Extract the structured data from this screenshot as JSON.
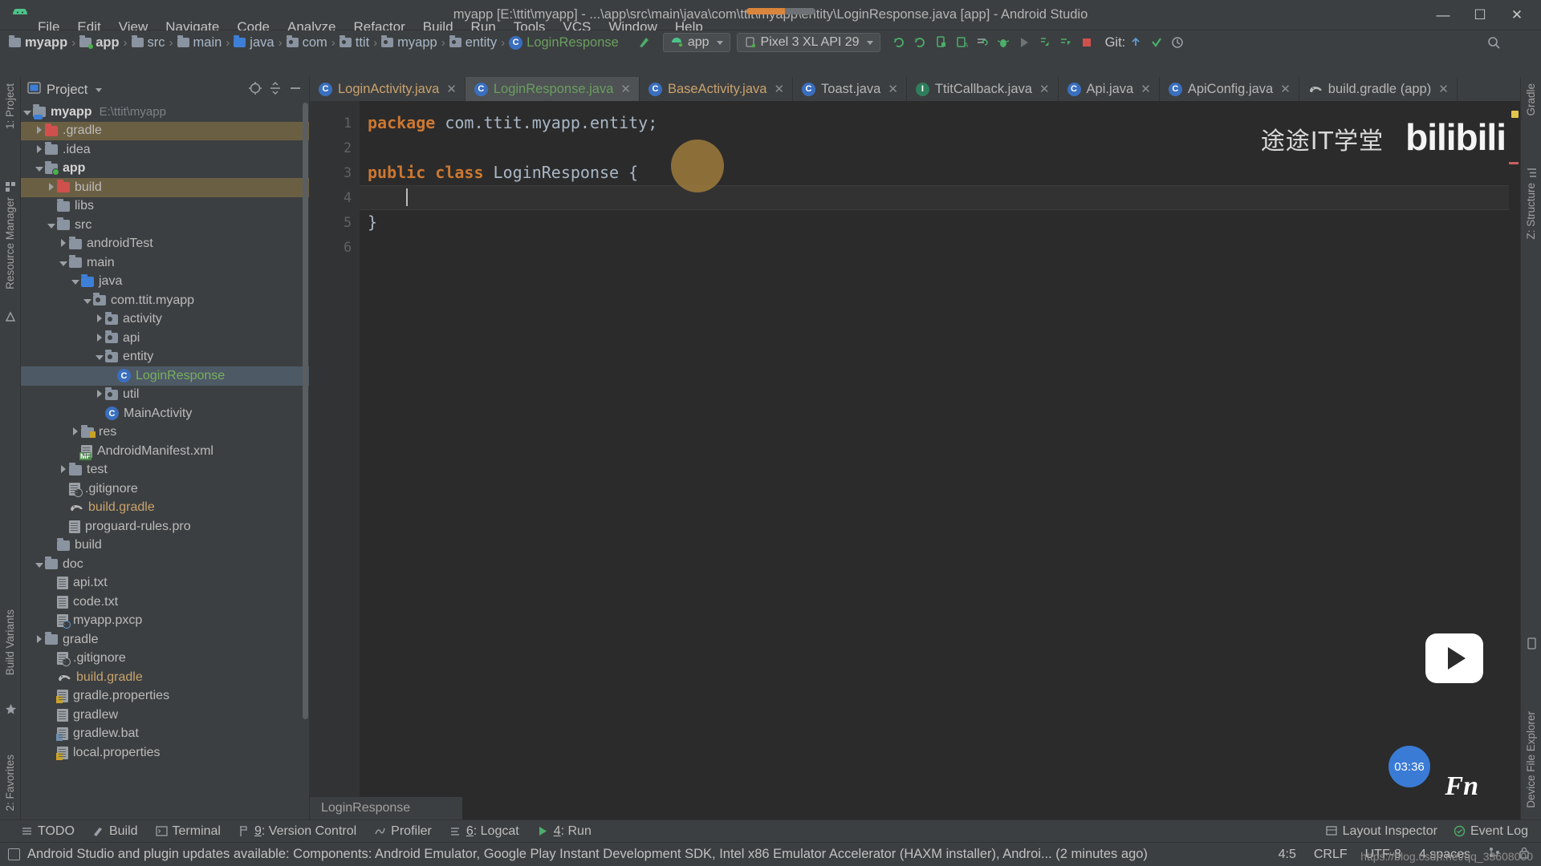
{
  "window": {
    "title": "myapp [E:\\ttit\\myapp] - ...\\app\\src\\main\\java\\com\\ttit\\myapp\\entity\\LoginResponse.java [app] - Android Studio",
    "minimize": "—",
    "maximize": "☐",
    "close": "✕"
  },
  "menubar": {
    "items": [
      {
        "label": "File"
      },
      {
        "label": "Edit"
      },
      {
        "label": "View"
      },
      {
        "label": "Navigate"
      },
      {
        "label": "Code"
      },
      {
        "label": "Analyze"
      },
      {
        "label": "Refactor"
      },
      {
        "label": "Build"
      },
      {
        "label": "Run"
      },
      {
        "label": "Tools"
      },
      {
        "label": "VCS"
      },
      {
        "label": "Window"
      },
      {
        "label": "Help"
      }
    ]
  },
  "breadcrumb": {
    "items": [
      {
        "label": "myapp",
        "icon": "folder-project",
        "bold": true
      },
      {
        "label": "app",
        "icon": "folder-module",
        "bold": true
      },
      {
        "label": "src",
        "icon": "folder",
        "bold": false
      },
      {
        "label": "main",
        "icon": "folder",
        "bold": false
      },
      {
        "label": "java",
        "icon": "folder-source",
        "bold": false
      },
      {
        "label": "com",
        "icon": "folder-package",
        "bold": false
      },
      {
        "label": "ttit",
        "icon": "folder-package",
        "bold": false
      },
      {
        "label": "myapp",
        "icon": "folder-package",
        "bold": false
      },
      {
        "label": "entity",
        "icon": "folder-package",
        "bold": false
      },
      {
        "label": "LoginResponse",
        "icon": "class-icon",
        "bold": false
      }
    ],
    "separator": "›"
  },
  "toolbar": {
    "run_config": "app",
    "device": "Pixel 3 XL API 29",
    "git_label": "Git:",
    "icons": [
      "sync-gradle-icon",
      "avd-manager-icon",
      "sdk-manager-icon",
      "search-everywhere-icon",
      "project-structure-icon",
      "stop-icon",
      "run-icon",
      "debug-icon",
      "attach-debugger-icon",
      "profile-icon",
      "apply-changes-icon",
      "stop-app-icon",
      "commit-icon",
      "update-icon",
      "history-icon"
    ]
  },
  "project_panel": {
    "title": "Project",
    "select_opened_file_icon": "target-icon",
    "collapse_all_icon": "collapse-icon",
    "hide_icon": "minimize-icon",
    "tree": [
      {
        "label": "myapp",
        "path": "E:\\ttit\\myapp",
        "depth": 0,
        "arrow": "open",
        "icon": "folder-project",
        "bold": true,
        "state": "none"
      },
      {
        "label": ".gradle",
        "depth": 1,
        "arrow": "closed",
        "icon": "folder-red",
        "state": "hl"
      },
      {
        "label": ".idea",
        "depth": 1,
        "arrow": "closed",
        "icon": "folder",
        "state": "none"
      },
      {
        "label": "app",
        "depth": 1,
        "arrow": "open",
        "icon": "folder-module",
        "bold": true,
        "state": "none"
      },
      {
        "label": "build",
        "depth": 2,
        "arrow": "closed",
        "icon": "folder-red",
        "state": "hl"
      },
      {
        "label": "libs",
        "depth": 2,
        "arrow": "none",
        "icon": "folder",
        "state": "none"
      },
      {
        "label": "src",
        "depth": 2,
        "arrow": "open",
        "icon": "folder",
        "state": "none"
      },
      {
        "label": "androidTest",
        "depth": 3,
        "arrow": "closed",
        "icon": "folder",
        "state": "none"
      },
      {
        "label": "main",
        "depth": 3,
        "arrow": "open",
        "icon": "folder",
        "state": "none"
      },
      {
        "label": "java",
        "depth": 4,
        "arrow": "open",
        "icon": "folder-source",
        "state": "none"
      },
      {
        "label": "com.ttit.myapp",
        "depth": 5,
        "arrow": "open",
        "icon": "folder-package",
        "state": "none"
      },
      {
        "label": "activity",
        "depth": 6,
        "arrow": "closed",
        "icon": "folder-package",
        "state": "none"
      },
      {
        "label": "api",
        "depth": 6,
        "arrow": "closed",
        "icon": "folder-package",
        "state": "none"
      },
      {
        "label": "entity",
        "depth": 6,
        "arrow": "open",
        "icon": "folder-package",
        "state": "none"
      },
      {
        "label": "LoginResponse",
        "depth": 7,
        "arrow": "none",
        "icon": "class-icon",
        "color": "green",
        "state": "sel"
      },
      {
        "label": "util",
        "depth": 6,
        "arrow": "closed",
        "icon": "folder-package",
        "state": "none"
      },
      {
        "label": "MainActivity",
        "depth": 6,
        "arrow": "none",
        "icon": "class-icon",
        "state": "none"
      },
      {
        "label": "res",
        "depth": 4,
        "arrow": "closed",
        "icon": "folder-res",
        "state": "none"
      },
      {
        "label": "AndroidManifest.xml",
        "depth": 4,
        "arrow": "none",
        "icon": "manifest-icon",
        "state": "none"
      },
      {
        "label": "test",
        "depth": 3,
        "arrow": "closed",
        "icon": "folder",
        "state": "none"
      },
      {
        "label": ".gitignore",
        "depth": 3,
        "arrow": "none",
        "icon": "gitignore-icon",
        "state": "none"
      },
      {
        "label": "build.gradle",
        "depth": 3,
        "arrow": "none",
        "icon": "gradle-icon",
        "color": "gradle",
        "state": "none"
      },
      {
        "label": "proguard-rules.pro",
        "depth": 3,
        "arrow": "none",
        "icon": "file-icon",
        "state": "none"
      },
      {
        "label": "build",
        "depth": 2,
        "arrow": "none",
        "icon": "folder",
        "state": "none"
      },
      {
        "label": "doc",
        "depth": 1,
        "arrow": "open",
        "icon": "folder",
        "state": "none"
      },
      {
        "label": "api.txt",
        "depth": 2,
        "arrow": "none",
        "icon": "file-icon",
        "state": "none"
      },
      {
        "label": "code.txt",
        "depth": 2,
        "arrow": "none",
        "icon": "file-icon",
        "state": "none"
      },
      {
        "label": "myapp.pxcp",
        "depth": 2,
        "arrow": "none",
        "icon": "pxcp-icon",
        "state": "none"
      },
      {
        "label": "gradle",
        "depth": 1,
        "arrow": "closed",
        "icon": "folder",
        "state": "none"
      },
      {
        "label": ".gitignore",
        "depth": 2,
        "arrow": "none",
        "icon": "gitignore-icon",
        "state": "none"
      },
      {
        "label": "build.gradle",
        "depth": 2,
        "arrow": "none",
        "icon": "gradle-icon",
        "color": "gradle",
        "state": "none"
      },
      {
        "label": "gradle.properties",
        "depth": 2,
        "arrow": "none",
        "icon": "properties-icon",
        "state": "none"
      },
      {
        "label": "gradlew",
        "depth": 2,
        "arrow": "none",
        "icon": "file-icon",
        "state": "none"
      },
      {
        "label": "gradlew.bat",
        "depth": 2,
        "arrow": "none",
        "icon": "bat-icon",
        "state": "none"
      },
      {
        "label": "local.properties",
        "depth": 2,
        "arrow": "none",
        "icon": "properties-icon",
        "state": "none"
      }
    ]
  },
  "left_rail": {
    "items": [
      {
        "label": "1: Project"
      },
      {
        "label": "Resource Manager"
      },
      {
        "label": "Build Variants"
      },
      {
        "label": "2: Favorites"
      }
    ]
  },
  "right_rail": {
    "items": [
      {
        "label": "Gradle"
      },
      {
        "label": "Z: Structure"
      },
      {
        "label": "Device File Explorer"
      }
    ]
  },
  "editor": {
    "tabs": [
      {
        "label": "LoginActivity.java",
        "icon": "class-icon",
        "color": "amber",
        "active": false
      },
      {
        "label": "LoginResponse.java",
        "icon": "class-icon",
        "color": "green",
        "active": true
      },
      {
        "label": "BaseActivity.java",
        "icon": "class-icon",
        "color": "amber",
        "active": false
      },
      {
        "label": "Toast.java",
        "icon": "class-icon",
        "color": "grey",
        "active": false
      },
      {
        "label": "TtitCallback.java",
        "icon": "interface-icon",
        "color": "grey",
        "active": false
      },
      {
        "label": "Api.java",
        "icon": "class-icon",
        "color": "grey",
        "active": false
      },
      {
        "label": "ApiConfig.java",
        "icon": "class-icon",
        "color": "grey",
        "active": false
      },
      {
        "label": "build.gradle (app)",
        "icon": "gradle-icon",
        "color": "grey",
        "active": false
      }
    ],
    "close_glyph": "✕",
    "line_numbers": [
      "1",
      "2",
      "3",
      "4",
      "5",
      "6"
    ],
    "code_lines": [
      {
        "tokens": [
          {
            "t": "package",
            "c": "kw"
          },
          {
            "t": " com.ttit.myapp.entity;",
            "c": "plain"
          }
        ]
      },
      {
        "tokens": []
      },
      {
        "tokens": [
          {
            "t": "public",
            "c": "kw"
          },
          {
            "t": " ",
            "c": "plain"
          },
          {
            "t": "class",
            "c": "kw"
          },
          {
            "t": " LoginResponse {",
            "c": "plain"
          }
        ]
      },
      {
        "tokens": [],
        "caret": true
      },
      {
        "tokens": [
          {
            "t": "}",
            "c": "plain"
          }
        ]
      },
      {
        "tokens": []
      }
    ],
    "footer_breadcrumb": "LoginResponse"
  },
  "toolwindow_bar": {
    "items": [
      {
        "label": "TODO",
        "icon": "todo-icon",
        "mnemonic": ""
      },
      {
        "label": "Build",
        "icon": "build-icon",
        "mnemonic": ""
      },
      {
        "label": "Terminal",
        "icon": "terminal-icon",
        "mnemonic": ""
      },
      {
        "label": "Version Control",
        "icon": "vcs-icon",
        "mnemonic": "9"
      },
      {
        "label": "Profiler",
        "icon": "profiler-icon",
        "mnemonic": ""
      },
      {
        "label": "Logcat",
        "icon": "logcat-icon",
        "mnemonic": "6"
      },
      {
        "label": "Run",
        "icon": "run-icon",
        "mnemonic": "4"
      }
    ],
    "right_items": [
      {
        "label": "Layout Inspector",
        "icon": "layout-inspector-icon"
      },
      {
        "label": "Event Log",
        "icon": "event-log-icon"
      }
    ]
  },
  "statusbar": {
    "message": "Android Studio and plugin updates available: Components: Android Emulator, Google Play Instant Development SDK, Intel x86 Emulator Accelerator (HAXM installer), Androi... (2 minutes ago)",
    "caret_position": "4:5",
    "line_separator": "CRLF",
    "encoding": "UTF-8",
    "indent": "4 spaces",
    "branch_icon": "git-branch-icon",
    "lock_icon": "lock-icon"
  },
  "watermarks": {
    "channel_cn": "途途IT学堂",
    "site": "bilibili",
    "timer": "03:36",
    "fn": "Fn",
    "blog_url": "https://blog.csdn.net/qq_33608000"
  },
  "colors": {
    "accent_blue": "#3a6fbf",
    "editor_bg": "#2b2b2b",
    "panel_bg": "#3c3f41",
    "selection": "#4e5966",
    "keyword": "#cc7832",
    "green_class": "#6a9e5f",
    "amber_tab": "#c9a26d"
  }
}
